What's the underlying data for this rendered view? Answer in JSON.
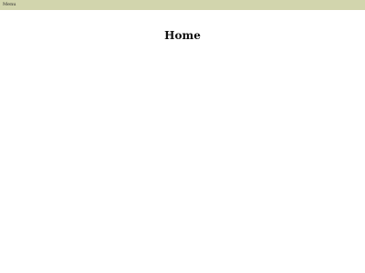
{
  "nav": {
    "menu_label": "Menu"
  },
  "page": {
    "title": "Home"
  },
  "colors": {
    "topbar_background": "#d2d5ad",
    "page_background": "#ffffff",
    "title_text": "#111111",
    "menu_text": "#2b2b2b"
  }
}
